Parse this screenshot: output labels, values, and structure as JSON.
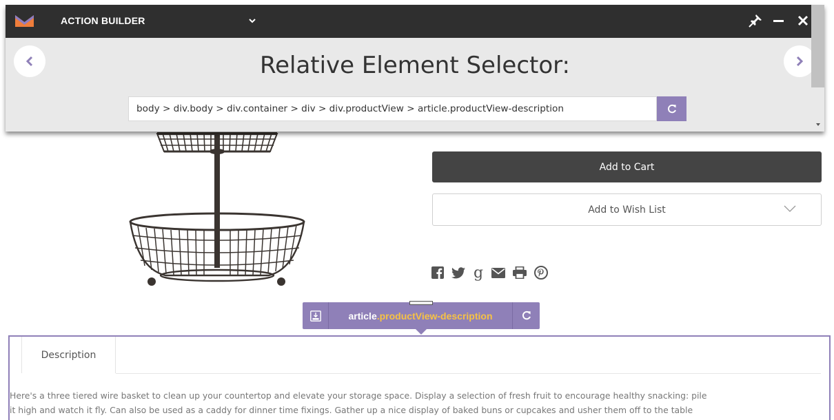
{
  "app": {
    "title": "ACTION BUILDER",
    "heading": "Relative Element Selector:",
    "selector_value": "body > div.body > div.container > div > div.productView > article.productView-description"
  },
  "product": {
    "add_to_cart": "Add to Cart",
    "add_to_wishlist": "Add to Wish List",
    "share_icons": [
      "facebook-icon",
      "twitter-icon",
      "google-plus-icon",
      "email-icon",
      "print-icon",
      "pinterest-icon"
    ]
  },
  "badge": {
    "tag": "article",
    "class_name": ".productView-description"
  },
  "description": {
    "tab_label": "Description",
    "lines": [
      "Here's a three tiered wire basket to clean up your countertop and elevate your storage space. Display a selection of fresh fruit to encourage healthy snacking: pile",
      "it high and watch it fly. Can also be used as a caddy for dinner time fixings. Gather up a nice display of baked buns or cupcakes and usher them off to the table"
    ]
  },
  "colors": {
    "header_bg": "#2f2f2f",
    "accent": "#8f80b8",
    "highlight_class": "#f7c244",
    "cart_button": "#444444"
  }
}
